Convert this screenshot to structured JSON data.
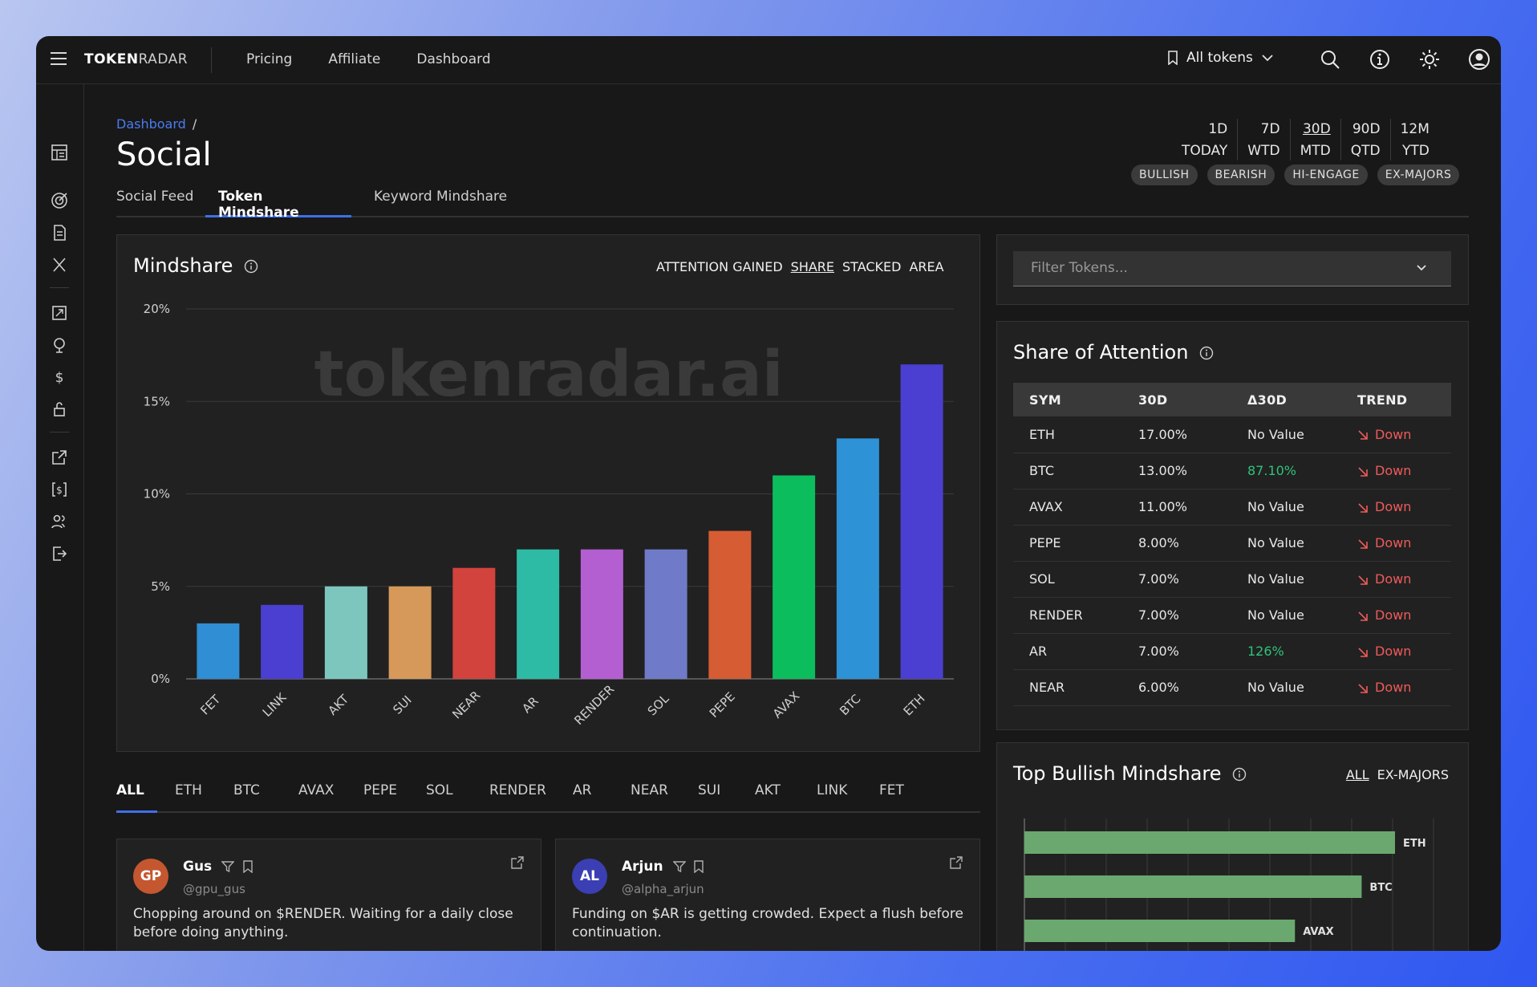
{
  "app": {
    "logo_bold": "TOKEN",
    "logo_light": "RADAR",
    "nav": [
      "Pricing",
      "Affiliate",
      "Dashboard"
    ],
    "token_selector": "All tokens"
  },
  "breadcrumb": {
    "root": "Dashboard",
    "sep": "/"
  },
  "page_title": "Social",
  "subtabs": [
    {
      "label": "Social Feed",
      "active": false
    },
    {
      "label": "Token Mindshare",
      "active": true
    },
    {
      "label": "Keyword Mindshare",
      "active": false
    }
  ],
  "periods": [
    {
      "top": "1D",
      "bottom": "TODAY",
      "selected": false
    },
    {
      "top": "7D",
      "bottom": "WTD",
      "selected": false
    },
    {
      "top": "30D",
      "bottom": "MTD",
      "selected": true
    },
    {
      "top": "90D",
      "bottom": "QTD",
      "selected": false
    },
    {
      "top": "12M",
      "bottom": "YTD",
      "selected": false
    }
  ],
  "chips": [
    "BULLISH",
    "BEARISH",
    "HI-ENGAGE",
    "EX-MAJORS"
  ],
  "mindshare": {
    "title": "Mindshare",
    "modes": [
      "ATTENTION GAINED",
      "SHARE",
      "STACKED",
      "AREA"
    ],
    "selected_mode": "SHARE",
    "watermark": "tokenradar.ai"
  },
  "chart_data": {
    "type": "bar",
    "categories": [
      "FET",
      "LINK",
      "AKT",
      "SUI",
      "NEAR",
      "AR",
      "RENDER",
      "SOL",
      "PEPE",
      "AVAX",
      "BTC",
      "ETH"
    ],
    "values": [
      3,
      4,
      5,
      5,
      6,
      7,
      7,
      7,
      8,
      11,
      13,
      17
    ],
    "colors": [
      "#2f8ed4",
      "#4a3fd0",
      "#7cc6bd",
      "#d6995a",
      "#d2433d",
      "#2dbba6",
      "#b35fd1",
      "#6f7bc8",
      "#d65c34",
      "#0cbd5e",
      "#2e92d6",
      "#4a3fd0"
    ],
    "y_ticks": [
      "0%",
      "5%",
      "10%",
      "15%",
      "20%"
    ],
    "ylim": [
      0,
      20
    ],
    "grid": true
  },
  "filter": {
    "placeholder": "Filter Tokens..."
  },
  "share_of_attention": {
    "title": "Share of Attention",
    "columns": [
      "SYM",
      "30D",
      "Δ30D",
      "TREND"
    ],
    "rows": [
      {
        "sym": "ETH",
        "v30": "17.00%",
        "delta": "No Value",
        "delta_pos": false,
        "trend": "Down"
      },
      {
        "sym": "BTC",
        "v30": "13.00%",
        "delta": "87.10%",
        "delta_pos": true,
        "trend": "Down"
      },
      {
        "sym": "AVAX",
        "v30": "11.00%",
        "delta": "No Value",
        "delta_pos": false,
        "trend": "Down"
      },
      {
        "sym": "PEPE",
        "v30": "8.00%",
        "delta": "No Value",
        "delta_pos": false,
        "trend": "Down"
      },
      {
        "sym": "SOL",
        "v30": "7.00%",
        "delta": "No Value",
        "delta_pos": false,
        "trend": "Down"
      },
      {
        "sym": "RENDER",
        "v30": "7.00%",
        "delta": "No Value",
        "delta_pos": false,
        "trend": "Down"
      },
      {
        "sym": "AR",
        "v30": "7.00%",
        "delta": "126%",
        "delta_pos": true,
        "trend": "Down"
      },
      {
        "sym": "NEAR",
        "v30": "6.00%",
        "delta": "No Value",
        "delta_pos": false,
        "trend": "Down"
      }
    ]
  },
  "token_tabs": [
    "ALL",
    "ETH",
    "BTC",
    "AVAX",
    "PEPE",
    "SOL",
    "RENDER",
    "AR",
    "NEAR",
    "SUI",
    "AKT",
    "LINK",
    "FET"
  ],
  "posts": [
    {
      "initials": "GP",
      "color": "#c4572f",
      "name": "Gus",
      "handle": "@gpu_gus",
      "text": "Chopping around on $RENDER. Waiting for a daily close before doing anything."
    },
    {
      "initials": "AL",
      "color": "#3b3fb3",
      "name": "Arjun",
      "handle": "@alpha_arjun",
      "text": "Funding on $AR is getting crowded. Expect a flush before continuation."
    }
  ],
  "top_bullish": {
    "title": "Top Bullish Mindshare",
    "modes": [
      "ALL",
      "EX-MAJORS"
    ],
    "selected_mode": "ALL",
    "bars": [
      {
        "label": "ETH",
        "value": 1.0
      },
      {
        "label": "BTC",
        "value": 0.91
      },
      {
        "label": "AVAX",
        "value": 0.73
      }
    ],
    "bar_color": "#6aa86f"
  }
}
